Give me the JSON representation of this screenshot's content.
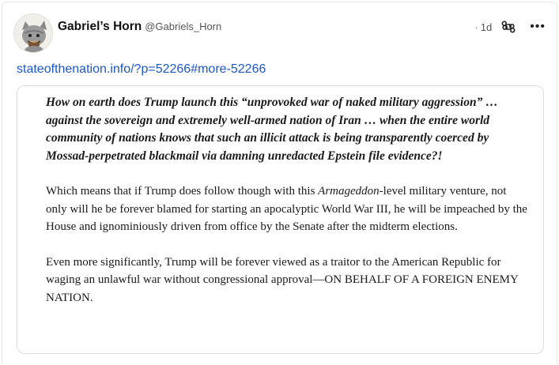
{
  "post": {
    "author": {
      "display_name": "Gabriel’s Horn",
      "handle": "@Gabriels_Horn",
      "avatar_icon": "cat-avatar-icon"
    },
    "age": "1d",
    "actions": {
      "command_icon": "command-icon",
      "more_label": "•••"
    },
    "link_text": "stateofthenation.info/?p=52266#more-52266",
    "quote": {
      "lead": "How on earth does Trump launch this “unprovoked war of naked military aggression” … against the sovereign and extremely well-armed nation of Iran … when the entire world community of nations knows that such an illicit attack is being transparently coerced by Mossad-perpetrated blackmail via damning unredacted Epstein file evidence?!",
      "para1_before": "Which means that if Trump does follow though with this ",
      "para1_em": "Armageddon",
      "para1_after": "-level military venture, not only will he be forever blamed for starting an apocalyptic World War III, he will be impeached by the House and ignominiously driven from office by the Senate after the midterm elections.",
      "para2": "Even more significantly, Trump will be forever viewed as a traitor to the American Republic for waging an unlawful war without congressional approval—ON BEHALF OF A FOREIGN ENEMY NATION."
    }
  }
}
